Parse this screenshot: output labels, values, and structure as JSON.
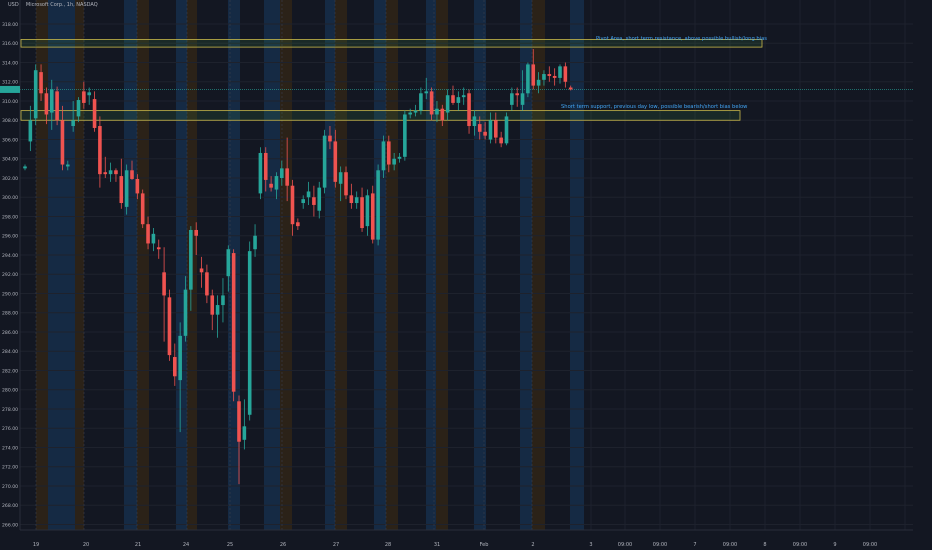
{
  "chart_data": {
    "type": "candlestick",
    "title": "Microsoft Corp., 1h, NASDAQ",
    "currency": "USD",
    "ylim": [
      266,
      319
    ],
    "y_ticks": [
      "318.00",
      "316.00",
      "314.00",
      "312.00",
      "310.00",
      "308.00",
      "306.00",
      "304.00",
      "302.00",
      "300.00",
      "298.00",
      "296.00",
      "294.00",
      "292.00",
      "290.00",
      "288.00",
      "286.00",
      "284.00",
      "282.00",
      "280.00",
      "278.00",
      "276.00",
      "274.00",
      "272.00",
      "270.00",
      "268.00",
      "266.00"
    ],
    "last_price_label": "",
    "x_tick_labels": [
      "19",
      "20",
      "21",
      "24",
      "25",
      "26",
      "27",
      "28",
      "31",
      "Feb",
      "2",
      "3",
      "09:00",
      "09:00",
      "7",
      "09:00",
      "8",
      "09:00",
      "9",
      "09:00"
    ],
    "candles": [
      {
        "o": 303.0,
        "h": 303.4,
        "l": 302.8,
        "c": 303.2
      },
      {
        "o": 305.8,
        "h": 309.5,
        "l": 304.8,
        "c": 308.0
      },
      {
        "o": 308.2,
        "h": 313.8,
        "l": 307.5,
        "c": 313.2
      },
      {
        "o": 313.0,
        "h": 313.8,
        "l": 310.0,
        "c": 310.8
      },
      {
        "o": 310.8,
        "h": 311.4,
        "l": 307.6,
        "c": 308.6
      },
      {
        "o": 308.8,
        "h": 312.2,
        "l": 307.0,
        "c": 311.2
      },
      {
        "o": 311.0,
        "h": 311.5,
        "l": 307.5,
        "c": 308.0
      },
      {
        "o": 308.0,
        "h": 309.5,
        "l": 302.8,
        "c": 303.4
      },
      {
        "o": 303.2,
        "h": 303.8,
        "l": 302.8,
        "c": 303.4
      },
      {
        "o": 307.4,
        "h": 310.0,
        "l": 306.8,
        "c": 308.0
      },
      {
        "o": 308.4,
        "h": 310.4,
        "l": 307.8,
        "c": 310.1
      },
      {
        "o": 311.0,
        "h": 312.0,
        "l": 309.2,
        "c": 309.8
      },
      {
        "o": 310.6,
        "h": 311.4,
        "l": 309.6,
        "c": 310.9
      },
      {
        "o": 310.2,
        "h": 311.0,
        "l": 306.8,
        "c": 307.2
      },
      {
        "o": 307.4,
        "h": 308.4,
        "l": 301.0,
        "c": 302.4
      },
      {
        "o": 302.6,
        "h": 304.2,
        "l": 302.0,
        "c": 302.4
      },
      {
        "o": 302.4,
        "h": 303.6,
        "l": 301.6,
        "c": 302.8
      },
      {
        "o": 302.8,
        "h": 303.0,
        "l": 301.6,
        "c": 302.4
      },
      {
        "o": 302.2,
        "h": 304.0,
        "l": 298.8,
        "c": 299.4
      },
      {
        "o": 299.0,
        "h": 303.4,
        "l": 298.2,
        "c": 302.8
      },
      {
        "o": 302.8,
        "h": 303.8,
        "l": 301.8,
        "c": 301.9
      },
      {
        "o": 301.9,
        "h": 302.4,
        "l": 299.8,
        "c": 300.4
      },
      {
        "o": 300.4,
        "h": 300.8,
        "l": 296.8,
        "c": 297.2
      },
      {
        "o": 297.2,
        "h": 298.0,
        "l": 294.6,
        "c": 295.2
      },
      {
        "o": 295.2,
        "h": 296.8,
        "l": 294.4,
        "c": 296.2
      },
      {
        "o": 294.8,
        "h": 295.6,
        "l": 293.6,
        "c": 294.6
      },
      {
        "o": 292.2,
        "h": 294.8,
        "l": 285.0,
        "c": 289.8
      },
      {
        "o": 289.6,
        "h": 290.4,
        "l": 283.0,
        "c": 283.6
      },
      {
        "o": 283.4,
        "h": 284.8,
        "l": 280.4,
        "c": 281.4
      },
      {
        "o": 281.0,
        "h": 287.0,
        "l": 275.6,
        "c": 285.6
      },
      {
        "o": 285.6,
        "h": 291.8,
        "l": 285.0,
        "c": 290.4
      },
      {
        "o": 290.4,
        "h": 297.0,
        "l": 288.2,
        "c": 296.6
      },
      {
        "o": 296.6,
        "h": 297.4,
        "l": 294.0,
        "c": 296.0
      },
      {
        "o": 292.6,
        "h": 293.8,
        "l": 290.6,
        "c": 292.2
      },
      {
        "o": 292.2,
        "h": 293.0,
        "l": 289.0,
        "c": 289.8
      },
      {
        "o": 289.8,
        "h": 290.4,
        "l": 286.2,
        "c": 287.8
      },
      {
        "o": 287.8,
        "h": 289.8,
        "l": 285.4,
        "c": 288.8
      },
      {
        "o": 288.8,
        "h": 291.6,
        "l": 287.0,
        "c": 289.8
      },
      {
        "o": 291.8,
        "h": 295.0,
        "l": 290.2,
        "c": 294.6
      },
      {
        "o": 294.2,
        "h": 294.6,
        "l": 278.8,
        "c": 279.8
      },
      {
        "o": 278.8,
        "h": 279.4,
        "l": 270.2,
        "c": 274.6
      },
      {
        "o": 274.8,
        "h": 279.0,
        "l": 273.8,
        "c": 276.2
      },
      {
        "o": 277.4,
        "h": 295.4,
        "l": 276.8,
        "c": 294.4
      },
      {
        "o": 294.6,
        "h": 297.2,
        "l": 293.8,
        "c": 296.0
      },
      {
        "o": 300.4,
        "h": 305.2,
        "l": 299.8,
        "c": 304.6
      },
      {
        "o": 304.6,
        "h": 305.2,
        "l": 300.6,
        "c": 301.8
      },
      {
        "o": 301.4,
        "h": 302.2,
        "l": 300.6,
        "c": 301.0
      },
      {
        "o": 300.8,
        "h": 302.6,
        "l": 299.8,
        "c": 302.2
      },
      {
        "o": 302.0,
        "h": 303.8,
        "l": 301.2,
        "c": 303.0
      },
      {
        "o": 303.0,
        "h": 306.2,
        "l": 299.6,
        "c": 301.2
      },
      {
        "o": 301.2,
        "h": 301.8,
        "l": 296.0,
        "c": 297.2
      },
      {
        "o": 297.4,
        "h": 297.8,
        "l": 296.6,
        "c": 297.0
      },
      {
        "o": 299.4,
        "h": 300.2,
        "l": 298.8,
        "c": 299.8
      },
      {
        "o": 300.0,
        "h": 301.6,
        "l": 299.2,
        "c": 300.6
      },
      {
        "o": 300.0,
        "h": 301.2,
        "l": 298.0,
        "c": 299.2
      },
      {
        "o": 298.6,
        "h": 301.6,
        "l": 297.8,
        "c": 301.0
      },
      {
        "o": 301.0,
        "h": 307.0,
        "l": 300.4,
        "c": 306.4
      },
      {
        "o": 306.4,
        "h": 307.4,
        "l": 305.0,
        "c": 305.8
      },
      {
        "o": 305.8,
        "h": 307.0,
        "l": 301.0,
        "c": 301.6
      },
      {
        "o": 301.4,
        "h": 303.2,
        "l": 299.6,
        "c": 302.6
      },
      {
        "o": 302.6,
        "h": 303.2,
        "l": 299.8,
        "c": 300.2
      },
      {
        "o": 300.2,
        "h": 301.4,
        "l": 298.8,
        "c": 299.4
      },
      {
        "o": 299.4,
        "h": 300.6,
        "l": 298.8,
        "c": 300.0
      },
      {
        "o": 300.0,
        "h": 301.0,
        "l": 296.4,
        "c": 296.8
      },
      {
        "o": 297.0,
        "h": 300.8,
        "l": 296.0,
        "c": 300.2
      },
      {
        "o": 300.4,
        "h": 301.2,
        "l": 295.2,
        "c": 295.6
      },
      {
        "o": 295.6,
        "h": 303.4,
        "l": 295.0,
        "c": 302.8
      },
      {
        "o": 302.8,
        "h": 306.4,
        "l": 302.0,
        "c": 305.8
      },
      {
        "o": 305.8,
        "h": 306.4,
        "l": 302.6,
        "c": 303.4
      },
      {
        "o": 303.4,
        "h": 304.6,
        "l": 302.8,
        "c": 304.0
      },
      {
        "o": 304.0,
        "h": 304.6,
        "l": 303.6,
        "c": 304.2
      },
      {
        "o": 304.2,
        "h": 309.0,
        "l": 303.8,
        "c": 308.6
      },
      {
        "o": 308.6,
        "h": 309.2,
        "l": 308.2,
        "c": 308.8
      },
      {
        "o": 308.8,
        "h": 309.6,
        "l": 308.4,
        "c": 309.0
      },
      {
        "o": 309.0,
        "h": 311.4,
        "l": 308.6,
        "c": 310.8
      },
      {
        "o": 310.8,
        "h": 312.4,
        "l": 310.2,
        "c": 311.0
      },
      {
        "o": 311.0,
        "h": 311.4,
        "l": 308.0,
        "c": 308.6
      },
      {
        "o": 308.6,
        "h": 310.0,
        "l": 307.8,
        "c": 309.2
      },
      {
        "o": 309.2,
        "h": 309.6,
        "l": 307.4,
        "c": 308.0
      },
      {
        "o": 308.8,
        "h": 311.2,
        "l": 308.0,
        "c": 310.6
      },
      {
        "o": 310.6,
        "h": 311.6,
        "l": 309.6,
        "c": 309.8
      },
      {
        "o": 309.8,
        "h": 311.0,
        "l": 309.0,
        "c": 310.4
      },
      {
        "o": 310.4,
        "h": 311.4,
        "l": 309.6,
        "c": 310.6
      },
      {
        "o": 310.8,
        "h": 311.2,
        "l": 306.6,
        "c": 307.4
      },
      {
        "o": 307.4,
        "h": 309.0,
        "l": 306.4,
        "c": 308.4
      },
      {
        "o": 307.6,
        "h": 308.4,
        "l": 306.0,
        "c": 306.8
      },
      {
        "o": 306.8,
        "h": 307.8,
        "l": 306.0,
        "c": 306.4
      },
      {
        "o": 306.0,
        "h": 308.8,
        "l": 305.6,
        "c": 308.0
      },
      {
        "o": 308.0,
        "h": 308.8,
        "l": 305.6,
        "c": 306.2
      },
      {
        "o": 306.2,
        "h": 306.8,
        "l": 305.2,
        "c": 305.6
      },
      {
        "o": 305.6,
        "h": 308.8,
        "l": 305.4,
        "c": 308.4
      },
      {
        "o": 309.6,
        "h": 311.4,
        "l": 309.0,
        "c": 310.8
      },
      {
        "o": 310.8,
        "h": 311.4,
        "l": 309.4,
        "c": 310.6
      },
      {
        "o": 309.6,
        "h": 313.2,
        "l": 309.0,
        "c": 310.8
      },
      {
        "o": 310.8,
        "h": 314.0,
        "l": 310.4,
        "c": 313.8
      },
      {
        "o": 313.8,
        "h": 315.4,
        "l": 311.2,
        "c": 311.6
      },
      {
        "o": 311.6,
        "h": 313.0,
        "l": 310.8,
        "c": 312.2
      },
      {
        "o": 312.2,
        "h": 313.2,
        "l": 311.6,
        "c": 312.8
      },
      {
        "o": 312.8,
        "h": 313.6,
        "l": 312.0,
        "c": 312.6
      },
      {
        "o": 312.6,
        "h": 313.4,
        "l": 311.6,
        "c": 312.4
      },
      {
        "o": 312.4,
        "h": 313.8,
        "l": 311.8,
        "c": 313.6
      },
      {
        "o": 313.6,
        "h": 314.0,
        "l": 311.4,
        "c": 312.0
      },
      {
        "o": 311.4,
        "h": 311.6,
        "l": 311.1,
        "c": 311.2
      }
    ],
    "zones": [
      {
        "name": "Pivot Area",
        "low": 315.6,
        "high": 316.4,
        "x_start": "19",
        "x_end": "09:00",
        "label": "Pivot Area, short term resistance, above possible bullish/long bias"
      },
      {
        "name": "Short term support",
        "low": 308.0,
        "high": 309.0,
        "x_start": "19",
        "x_end": "09:00",
        "label": "Short term support, previous day low, possible bearish/short bias below"
      }
    ],
    "colors": {
      "background": "#131722",
      "up": "#26a69a",
      "down": "#ef5350",
      "grid": "#1e222d",
      "zone_border": "#c8b84a",
      "annotation": "#42a5f5",
      "session_blue": "#152a44",
      "session_orange": "#2b2218",
      "last_price": "#26a69a"
    },
    "grid": true
  }
}
